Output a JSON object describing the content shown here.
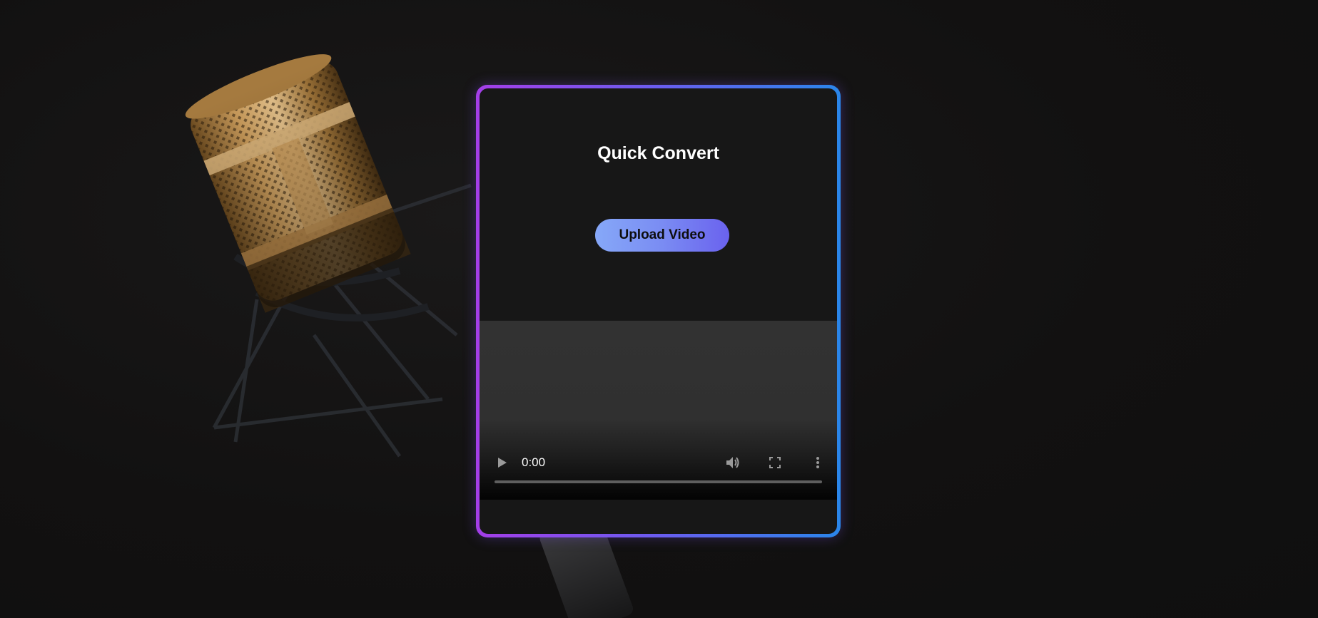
{
  "card": {
    "title": "Quick Convert",
    "upload_button_label": "Upload Video"
  },
  "video_player": {
    "time": "0:00",
    "progress": 0,
    "icons": [
      "play-icon",
      "volume-icon",
      "fullscreen-icon",
      "more-icon"
    ]
  },
  "background": {
    "subject": "microphone-image"
  },
  "colors": {
    "background": "#131212",
    "card": "#171717",
    "border_start": "#a43ee8",
    "border_end": "#2a86ea",
    "button_start": "#86a8f8",
    "button_end": "#6a62ee",
    "video_area": "#323232"
  }
}
